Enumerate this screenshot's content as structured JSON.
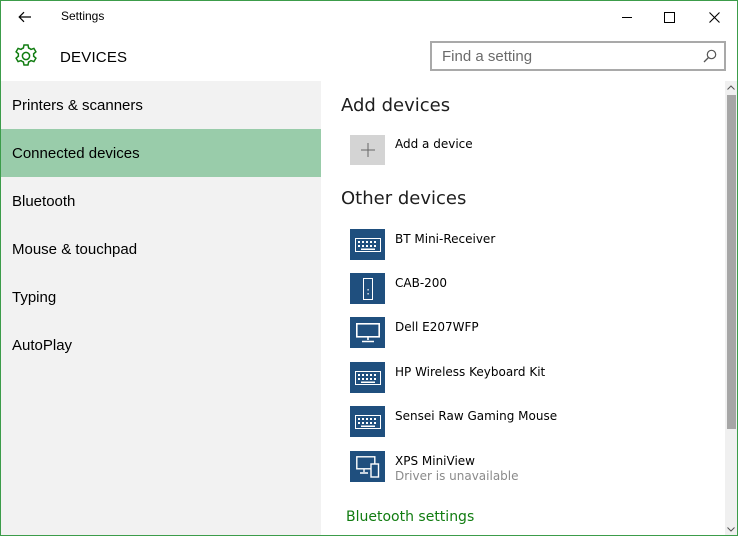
{
  "window": {
    "title": "Settings"
  },
  "header": {
    "title": "DEVICES"
  },
  "search": {
    "placeholder": "Find a setting",
    "value": ""
  },
  "sidebar": {
    "items": [
      {
        "label": "Printers & scanners",
        "selected": false
      },
      {
        "label": "Connected devices",
        "selected": true
      },
      {
        "label": "Bluetooth",
        "selected": false
      },
      {
        "label": "Mouse & touchpad",
        "selected": false
      },
      {
        "label": "Typing",
        "selected": false
      },
      {
        "label": "AutoPlay",
        "selected": false
      }
    ]
  },
  "content": {
    "add_section_title": "Add devices",
    "add_device_label": "Add a device",
    "other_section_title": "Other devices",
    "devices": [
      {
        "name": "BT Mini-Receiver",
        "icon": "keyboard-icon",
        "status": ""
      },
      {
        "name": "CAB-200",
        "icon": "speaker-icon",
        "status": ""
      },
      {
        "name": "Dell E207WFP",
        "icon": "monitor-icon",
        "status": ""
      },
      {
        "name": "HP Wireless Keyboard Kit",
        "icon": "keyboard-icon",
        "status": ""
      },
      {
        "name": "Sensei Raw Gaming Mouse",
        "icon": "keyboard-icon",
        "status": ""
      },
      {
        "name": "XPS MiniView",
        "icon": "computer-phone-icon",
        "status": "Driver is unavailable"
      }
    ],
    "bluetooth_link": "Bluetooth settings"
  },
  "colors": {
    "accent": "#107c10",
    "selected_nav": "#99ccaa",
    "device_tile": "#1f4f7e",
    "window_border": "#3c9c4a"
  }
}
